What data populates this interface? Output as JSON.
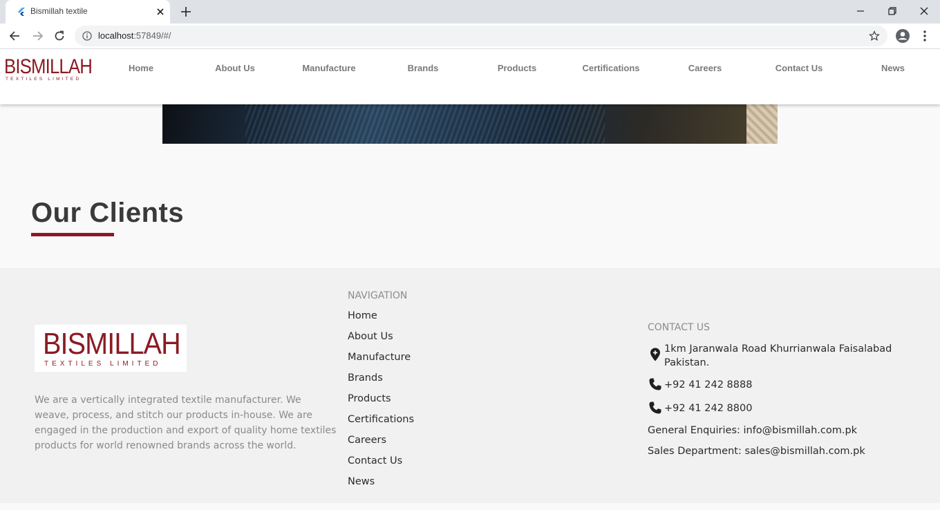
{
  "browser": {
    "tab_title": "Bismillah textile",
    "url_host": "localhost",
    "url_rest": ":57849/#/"
  },
  "site": {
    "logo": {
      "big": "BISMILLAH",
      "small": "TEXTILES LIMITED"
    },
    "menu": [
      {
        "label": "Home"
      },
      {
        "label": "About Us"
      },
      {
        "label": "Manufacture"
      },
      {
        "label": "Brands"
      },
      {
        "label": "Products"
      },
      {
        "label": "Certifications"
      },
      {
        "label": "Careers"
      },
      {
        "label": "Contact Us"
      },
      {
        "label": "News"
      }
    ]
  },
  "clients": {
    "title": "Our Clients",
    "accent_color": "#8b1a23"
  },
  "footer": {
    "logo": {
      "big": "BISMILLAH",
      "small": "TEXTILES LIMITED"
    },
    "about": "We are a vertically integrated textile manufacturer. We weave, process, and stitch our products in-house. We are engaged in the production and export of quality home textiles products for world renowned brands across the world.",
    "navigation": {
      "heading": "NAVIGATION",
      "links": [
        "Home",
        "About Us",
        "Manufacture",
        "Brands",
        "Products",
        "Certifications",
        "Careers",
        "Contact Us",
        "News"
      ]
    },
    "contact": {
      "heading": "CONTACT US",
      "address_line1": "1km Jaranwala Road Khurrianwala Faisalabad",
      "address_line2": "Pakistan.",
      "phone1": "+92 41 242 8888",
      "phone2": "+92 41 242 8800",
      "general_enquiries": "General Enquiries: info@bismillah.com.pk",
      "sales_department": "Sales Department: sales@bismillah.com.pk"
    }
  }
}
